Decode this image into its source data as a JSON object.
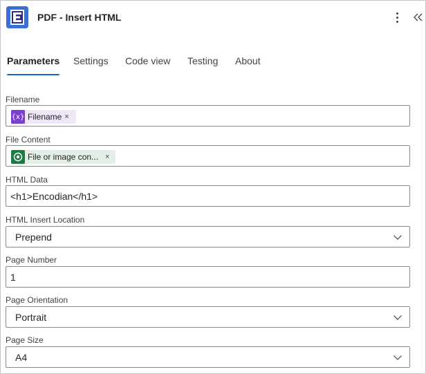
{
  "header": {
    "title": "PDF - Insert HTML",
    "more_icon": "more-vertical-icon",
    "collapse_icon": "double-chevron-left-icon"
  },
  "tabs": [
    {
      "label": "Parameters",
      "active": true
    },
    {
      "label": "Settings",
      "active": false
    },
    {
      "label": "Code view",
      "active": false
    },
    {
      "label": "Testing",
      "active": false
    },
    {
      "label": "About",
      "active": false
    }
  ],
  "fields": {
    "filename": {
      "label": "Filename",
      "token": {
        "label": "Filename",
        "icon": "expression-icon",
        "color": "#7b3fd1",
        "remove": "×"
      }
    },
    "file_content": {
      "label": "File Content",
      "token": {
        "label": "File or image con...",
        "icon": "sharepoint-icon",
        "color": "#1c7a43",
        "remove": "×"
      }
    },
    "html_data": {
      "label": "HTML Data",
      "value": "<h1>Encodian</h1>"
    },
    "html_insert_location": {
      "label": "HTML Insert Location",
      "value": "Prepend"
    },
    "page_number": {
      "label": "Page Number",
      "value": "1"
    },
    "page_orientation": {
      "label": "Page Orientation",
      "value": "Portrait"
    },
    "page_size": {
      "label": "Page Size",
      "value": "A4"
    }
  },
  "colors": {
    "accent": "#0f6cbd",
    "app_icon": "#3a6fd8"
  }
}
